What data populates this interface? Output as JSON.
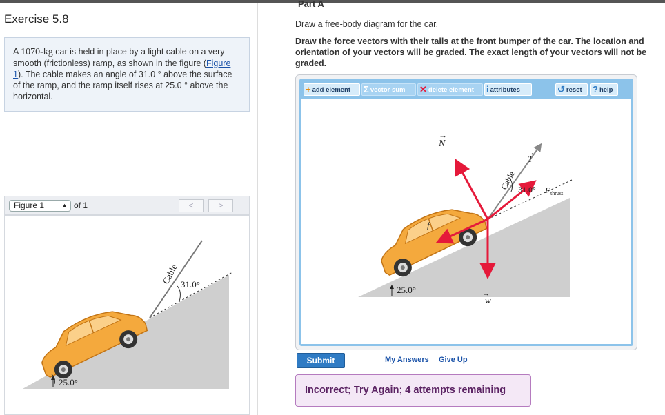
{
  "part_label": "Part A",
  "exercise_title": "Exercise 5.8",
  "problem": {
    "pre": "A ",
    "mass": "1070-kg",
    "body1": " car is held in place by a light cable on a very smooth (frictionless) ramp, as shown in the figure (",
    "figure_link": "Figure 1",
    "body2": "). The cable makes an angle of 31.0 ° above the surface of the ramp, and the ramp itself rises at 25.0 ° above the horizontal."
  },
  "figure_nav": {
    "selected": "Figure 1",
    "of_label": "of 1",
    "prev": "<",
    "next": ">"
  },
  "figure_labels": {
    "cable": "Cable",
    "cable_angle": "31.0°",
    "ramp_angle": "25.0°"
  },
  "instructions": {
    "line1": "Draw a free-body diagram for the car.",
    "line2": "Draw the force vectors with their tails at the front bumper of the car. The location and orientation of your vectors will be graded. The exact length of your vectors will not be graded."
  },
  "toolbar": {
    "add_element": "add element",
    "vector_sum": "vector sum",
    "delete_element": "delete element",
    "attributes": "attributes",
    "reset": "reset",
    "help": "help"
  },
  "diagram_labels": {
    "normal": "N",
    "tension": "T",
    "thrust": "F",
    "thrust_sub": "thrust",
    "friction": "f",
    "weight": "w",
    "cable": "Cable",
    "cable_angle": "31.0°",
    "ramp_angle": "25.0°"
  },
  "actions": {
    "submit": "Submit",
    "my_answers": "My Answers",
    "give_up": "Give Up"
  },
  "feedback": "Incorrect; Try Again; 4 attempts remaining",
  "colors": {
    "car_body": "#f4a93d",
    "vector": "#e5193a",
    "ramp": "#cfcfcf",
    "toolbar": "#8cc3ea",
    "submit": "#2f7bc4"
  }
}
